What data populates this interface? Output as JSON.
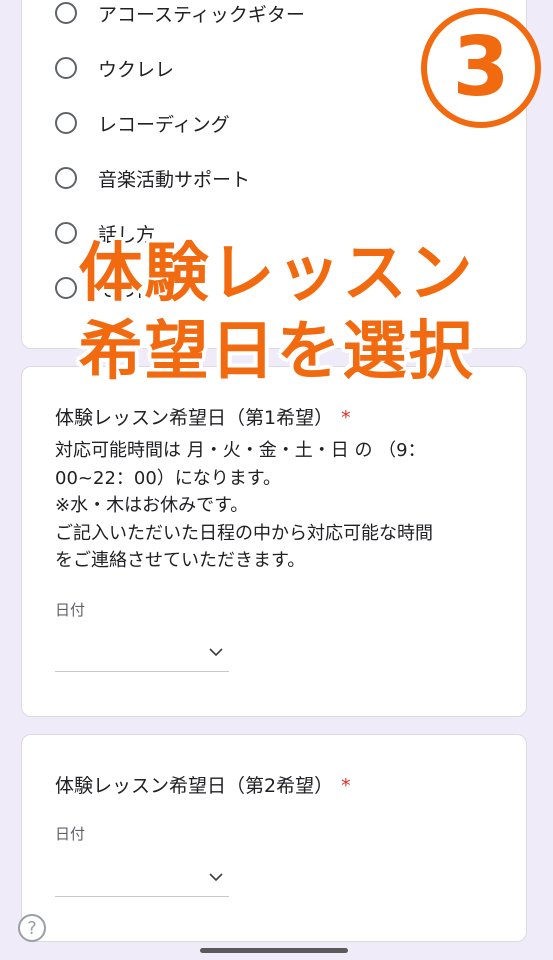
{
  "options": [
    {
      "label": "アコースティックギター"
    },
    {
      "label": "ウクレレ"
    },
    {
      "label": "レコーディング"
    },
    {
      "label": "音楽活動サポート"
    },
    {
      "label": "話し方"
    },
    {
      "label": "その他"
    }
  ],
  "overlay": {
    "badge": "3",
    "line1": "体験レッスン",
    "line2": "希望日を選択"
  },
  "question1": {
    "title": "体験レッスン希望日（第1希望）",
    "required_mark": "*",
    "description": [
      "対応可能時間は 月・火・金・土・日 の （9：",
      "00~22：00）になります。",
      "※水・木はお休みです。",
      "ご記入いただいた日程の中から対応可能な時間",
      "をご連絡させていただきます。"
    ],
    "field_label": "日付",
    "value": ""
  },
  "question2": {
    "title": "体験レッスン希望日（第2希望）",
    "required_mark": "*",
    "field_label": "日付",
    "value": ""
  },
  "icons": {
    "help": "?",
    "chevron": "chevron-down-icon"
  },
  "colors": {
    "background": "#efebf8",
    "overlay_accent": "#f26a10",
    "required": "#d93025"
  }
}
